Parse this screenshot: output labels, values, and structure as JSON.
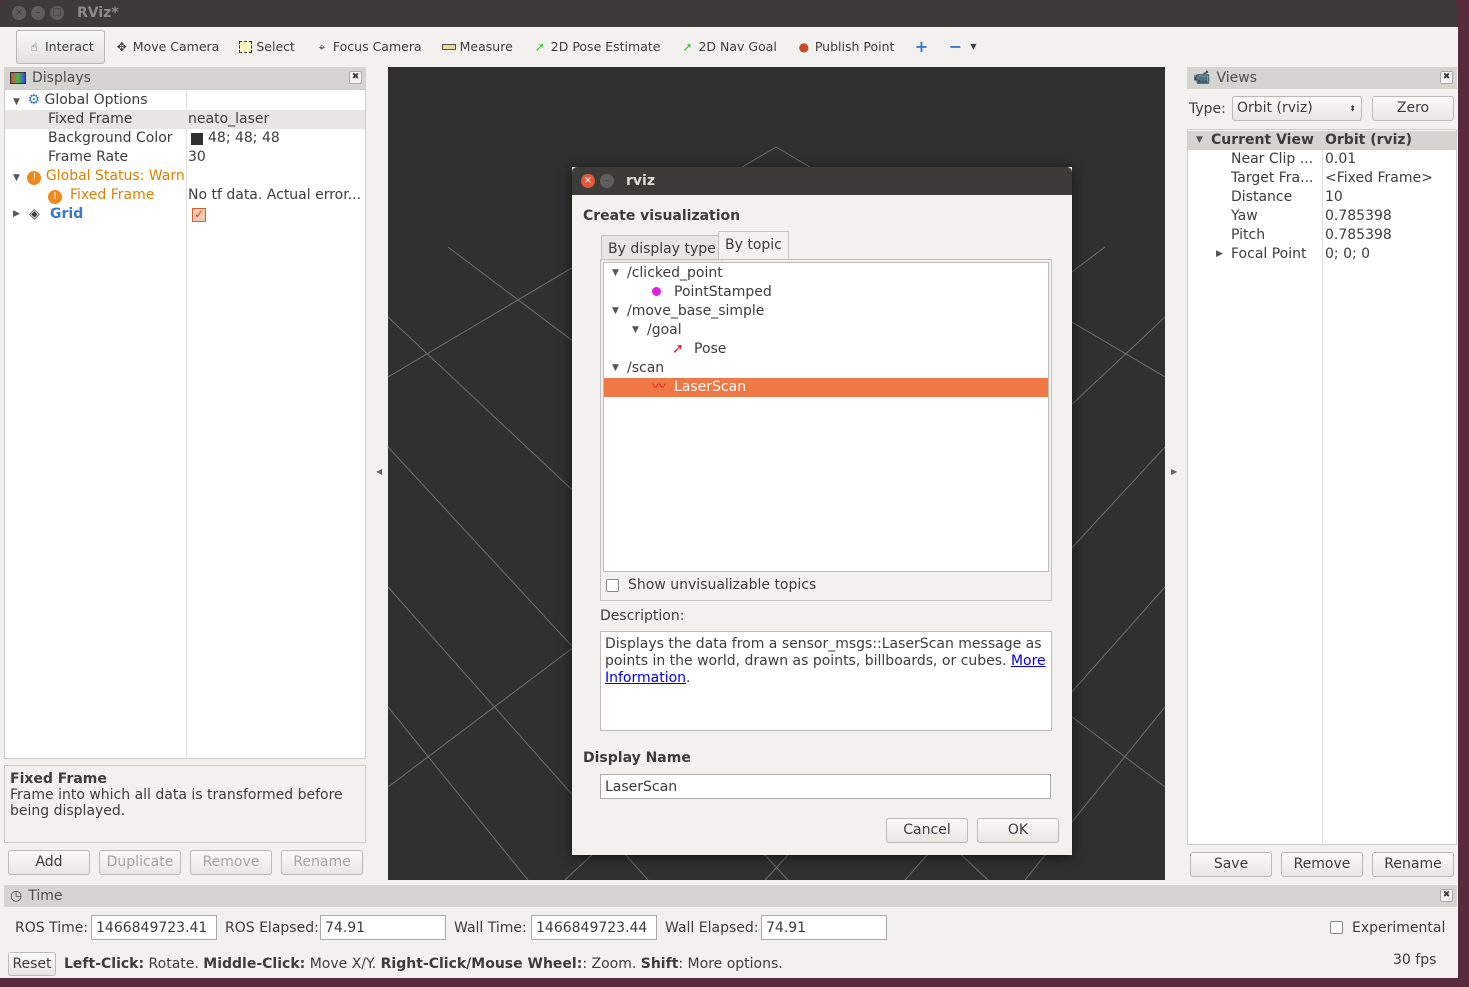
{
  "window": {
    "title": "RViz*"
  },
  "toolbar": {
    "items": [
      {
        "label": "Interact",
        "icon": "hand-cursor-icon"
      },
      {
        "label": "Move Camera",
        "icon": "move-camera-icon"
      },
      {
        "label": "Select",
        "icon": "select-box-icon"
      },
      {
        "label": "Focus Camera",
        "icon": "focus-crosshair-icon"
      },
      {
        "label": "Measure",
        "icon": "ruler-icon"
      },
      {
        "label": "2D Pose Estimate",
        "icon": "green-arrow-icon"
      },
      {
        "label": "2D Nav Goal",
        "icon": "green-arrow-icon"
      },
      {
        "label": "Publish Point",
        "icon": "map-pin-icon"
      }
    ]
  },
  "displays": {
    "title": "Displays",
    "global_options": "Global Options",
    "rows": [
      {
        "name": "Fixed Frame",
        "value": "neato_laser"
      },
      {
        "name": "Background Color",
        "value": "48; 48; 48"
      },
      {
        "name": "Frame Rate",
        "value": "30"
      }
    ],
    "global_status": "Global Status: Warn",
    "fixed_frame_status": {
      "name": "Fixed Frame",
      "value": "No tf data.  Actual error..."
    },
    "grid": "Grid",
    "grid_enabled": true,
    "description_title": "Fixed Frame",
    "description_text": "Frame into which all data is transformed before being displayed.",
    "buttons": {
      "add": "Add",
      "duplicate": "Duplicate",
      "remove": "Remove",
      "rename": "Rename"
    }
  },
  "dialog": {
    "title": "rviz",
    "heading": "Create visualization",
    "tabs": [
      "By display type",
      "By topic"
    ],
    "active_tab": 1,
    "topics": [
      {
        "label": "/clicked_point",
        "level": 0
      },
      {
        "label": "PointStamped",
        "level": 1,
        "icon": "magenta-dot-icon"
      },
      {
        "label": "/move_base_simple",
        "level": 0
      },
      {
        "label": "/goal",
        "level": 1
      },
      {
        "label": "Pose",
        "level": 2,
        "icon": "red-arrow-icon"
      },
      {
        "label": "/scan",
        "level": 0
      },
      {
        "label": "LaserScan",
        "level": 1,
        "icon": "laserscan-icon",
        "selected": true
      }
    ],
    "show_unvisualizable": "Show unvisualizable topics",
    "description_label": "Description:",
    "description_text": "Displays the data from a sensor_msgs::LaserScan message as points in the world, drawn as points, billboards, or cubes. ",
    "more_link_1": "More",
    "more_link_2": "Information",
    "display_name_label": "Display Name",
    "display_name_value": "LaserScan",
    "cancel": "Cancel",
    "ok": "OK",
    "selection_color": "#f07746"
  },
  "views": {
    "title": "Views",
    "type_label": "Type:",
    "type_value": "Orbit (rviz)",
    "zero": "Zero",
    "current_view": "Current View",
    "current_view_value": "Orbit (rviz)",
    "rows": [
      {
        "name": "Near Clip ...",
        "value": "0.01"
      },
      {
        "name": "Target Fra...",
        "value": "<Fixed Frame>"
      },
      {
        "name": "Distance",
        "value": "10"
      },
      {
        "name": "Yaw",
        "value": "0.785398"
      },
      {
        "name": "Pitch",
        "value": "0.785398"
      },
      {
        "name": "Focal Point",
        "value": "0; 0; 0"
      }
    ],
    "buttons": {
      "save": "Save",
      "remove": "Remove",
      "rename": "Rename"
    }
  },
  "time": {
    "title": "Time",
    "ros_time_label": "ROS Time:",
    "ros_time": "1466849723.41",
    "ros_elapsed_label": "ROS Elapsed:",
    "ros_elapsed": "74.91",
    "wall_time_label": "Wall Time:",
    "wall_time": "1466849723.44",
    "wall_elapsed_label": "Wall Elapsed:",
    "wall_elapsed": "74.91",
    "experimental": "Experimental"
  },
  "status": {
    "reset": "Reset",
    "parts": [
      [
        "Left-Click:",
        " Rotate. "
      ],
      [
        "Middle-Click:",
        " Move X/Y. "
      ],
      [
        "Right-Click/Mouse Wheel:",
        ": Zoom. "
      ],
      [
        "Shift",
        ": More options."
      ]
    ],
    "fps": "30 fps"
  }
}
